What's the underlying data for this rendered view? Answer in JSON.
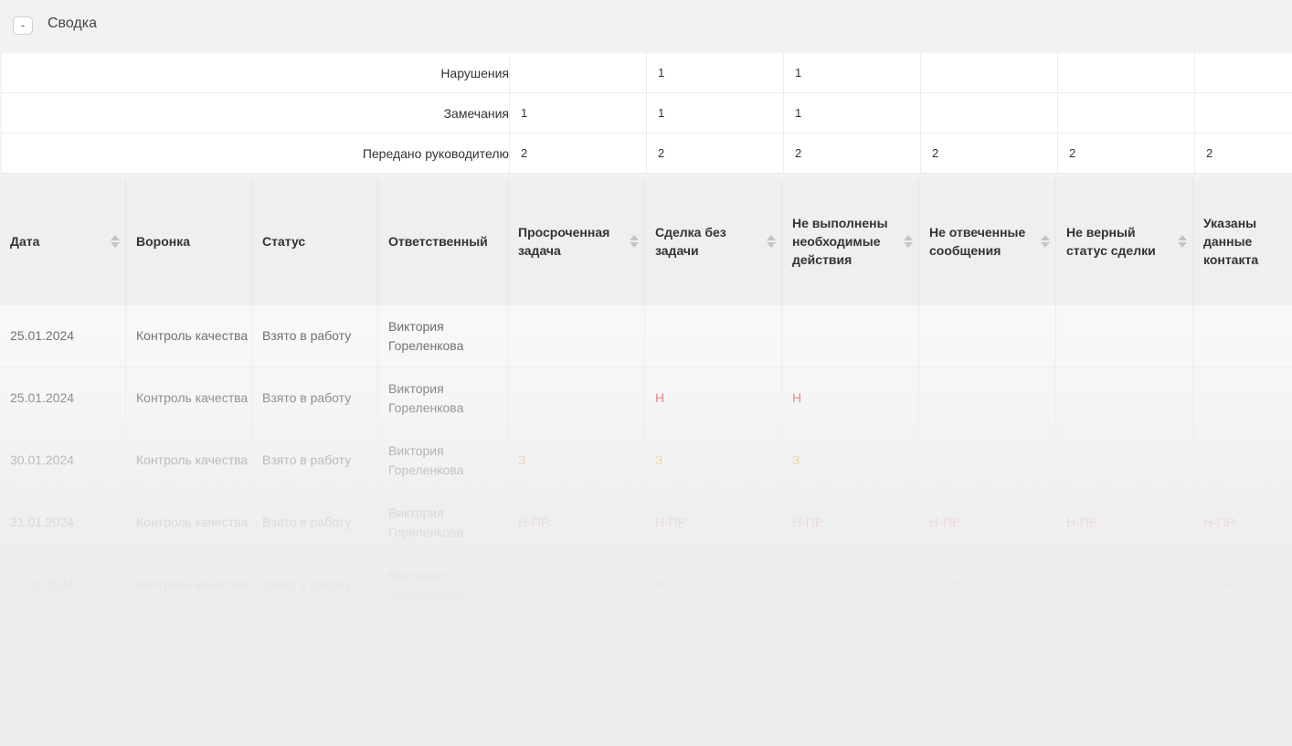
{
  "header": {
    "toggle_label": "-",
    "title": "Сводка"
  },
  "summary": {
    "rows": [
      {
        "label": "Нарушения",
        "values": [
          "",
          "1",
          "1",
          "",
          "",
          ""
        ]
      },
      {
        "label": "Замечания",
        "values": [
          "1",
          "1",
          "1",
          "",
          "",
          ""
        ]
      },
      {
        "label": "Передано руководителю",
        "values": [
          "2",
          "2",
          "2",
          "2",
          "2",
          "2"
        ]
      }
    ]
  },
  "table": {
    "columns": [
      {
        "label": "Дата",
        "sortable": true
      },
      {
        "label": "Воронка",
        "sortable": false
      },
      {
        "label": "Статус",
        "sortable": false
      },
      {
        "label": "Ответственный",
        "sortable": false
      },
      {
        "label": "Просроченная задача",
        "sortable": true
      },
      {
        "label": "Сделка без задачи",
        "sortable": true
      },
      {
        "label": "Не выполнены необходимые действия",
        "sortable": true
      },
      {
        "label": "Не отвеченные сообщения",
        "sortable": true
      },
      {
        "label": "Не верный статус сделки",
        "sortable": true
      },
      {
        "label": "Указаны данные контакта",
        "sortable": false
      }
    ],
    "rows": [
      {
        "date": "25.01.2024",
        "funnel": "Контроль качества",
        "status": "Взято в работу",
        "responsible": "Виктория Гореленкова",
        "marks": [
          "",
          "",
          "",
          "",
          "",
          ""
        ]
      },
      {
        "date": "25.01.2024",
        "funnel": "Контроль качества",
        "status": "Взято в работу",
        "responsible": "Виктория Гореленкова",
        "marks": [
          "",
          "Н",
          "Н",
          "",
          "",
          ""
        ]
      },
      {
        "date": "30.01.2024",
        "funnel": "Контроль качества",
        "status": "Взято в работу",
        "responsible": "Виктория Гореленкова",
        "marks": [
          "З",
          "З",
          "З",
          "",
          "",
          ""
        ]
      },
      {
        "date": "31.01.2024",
        "funnel": "Контроль качества",
        "status": "Взято в работу",
        "responsible": "Виктория Гореленкова",
        "marks": [
          "Н-ПР",
          "Н-ПР",
          "Н-ПР",
          "Н-ПР",
          "Н-ПР",
          "Н-ПР"
        ]
      },
      {
        "date": "31.01.2024",
        "funnel": "Контроль качества",
        "status": "Взято в работу",
        "responsible": "Виктория Гореленкова",
        "marks": [
          "Н-ПР",
          "Н-ПР",
          "Н-ПР",
          "Н-ПР",
          "Н-ПР",
          "Н-ПР"
        ]
      }
    ]
  },
  "colors": {
    "mark_violation": "#e05a5a",
    "mark_remark": "#e9a93a",
    "mark_escalated": "#d4608a"
  }
}
